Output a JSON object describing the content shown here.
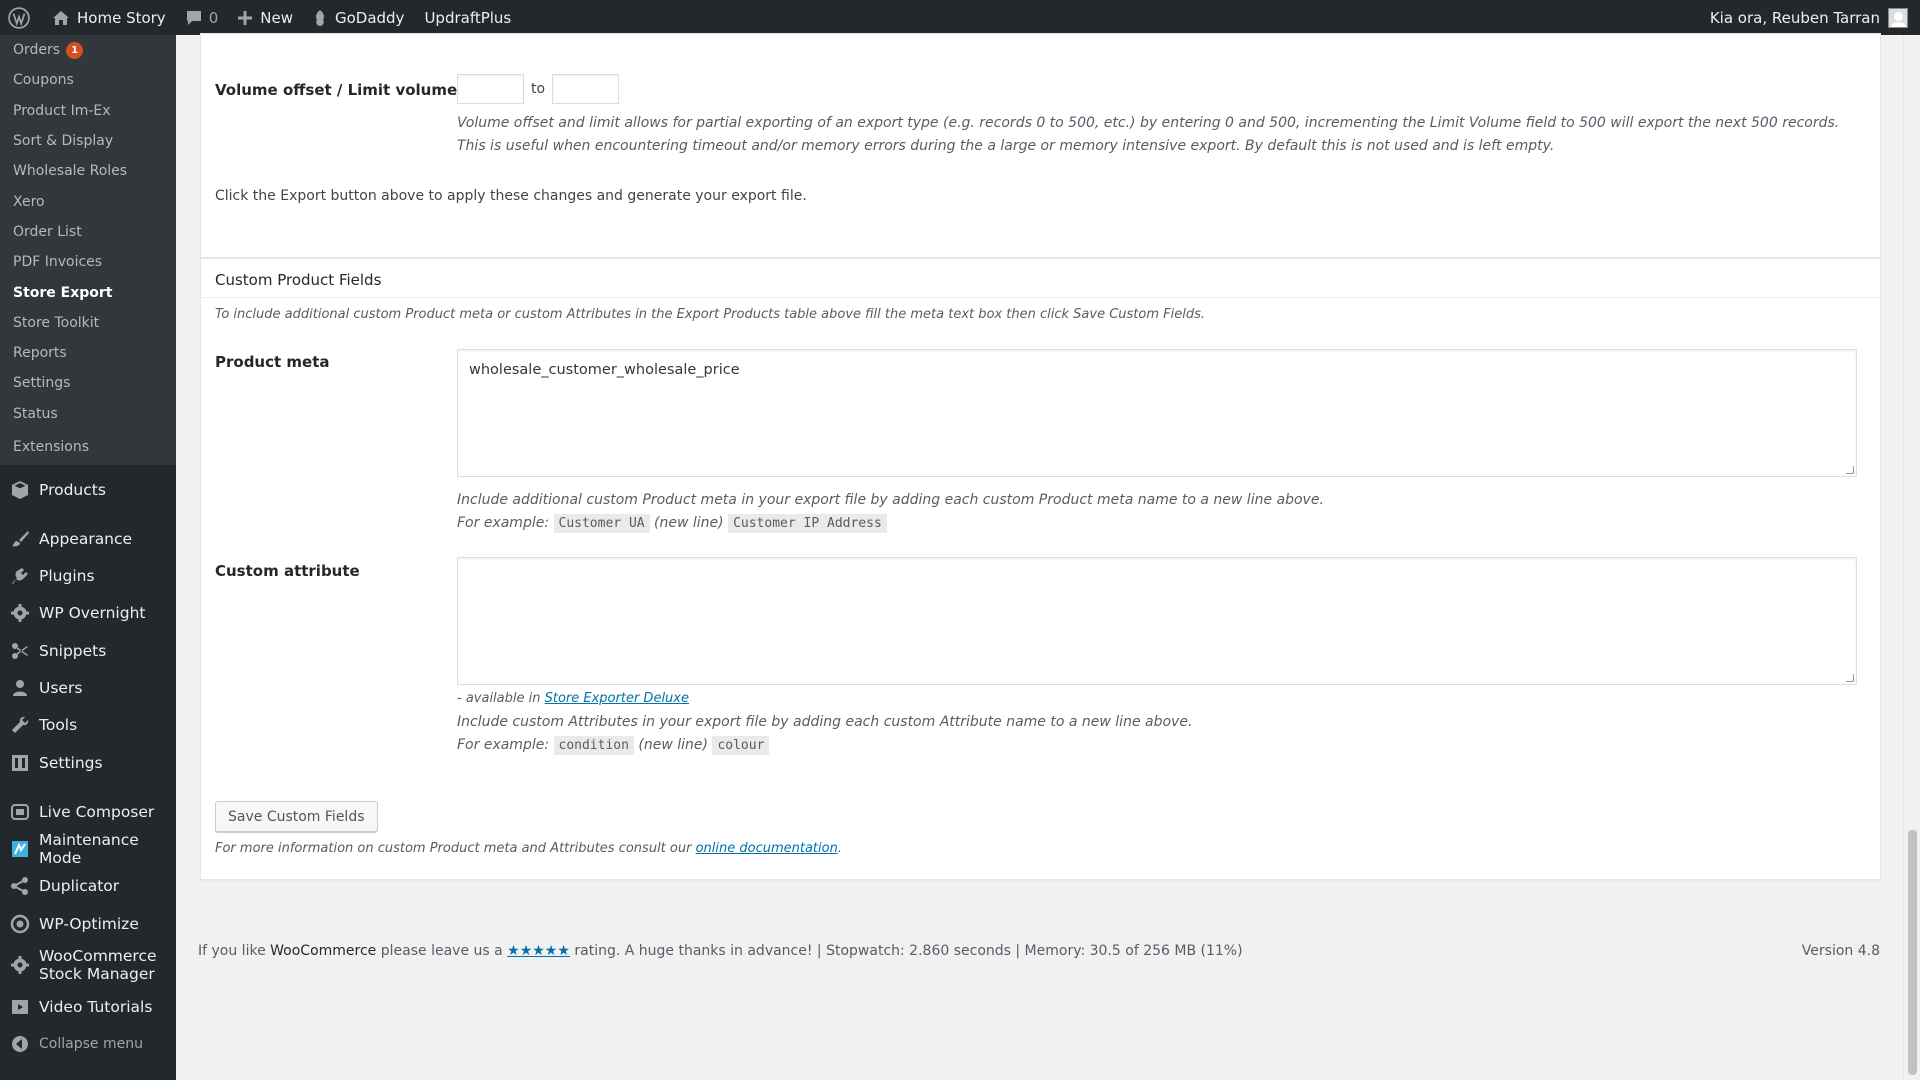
{
  "adminbar": {
    "site_name": "Home Story",
    "comments_count": "0",
    "new_label": "New",
    "godaddy_label": "GoDaddy",
    "updraft_label": "UpdraftPlus",
    "greeting": "Kia ora, Reuben Tarran"
  },
  "submenu": [
    {
      "label": "Orders",
      "badge": "1"
    },
    {
      "label": "Coupons"
    },
    {
      "label": "Product Im-Ex"
    },
    {
      "label": "Sort & Display"
    },
    {
      "label": "Wholesale Roles"
    },
    {
      "label": "Xero"
    },
    {
      "label": "Order List"
    },
    {
      "label": "PDF Invoices"
    },
    {
      "label": "Store Export",
      "current": true
    },
    {
      "label": "Store Toolkit"
    },
    {
      "label": "Reports"
    },
    {
      "label": "Settings"
    },
    {
      "label": "Status"
    },
    {
      "label": "Extensions"
    }
  ],
  "menu": {
    "products": "Products",
    "appearance": "Appearance",
    "plugins": "Plugins",
    "wp_overnight": "WP Overnight",
    "snippets": "Snippets",
    "users": "Users",
    "tools": "Tools",
    "settings": "Settings",
    "live_composer": "Live Composer",
    "maintenance_mode": "Maintenance Mode",
    "duplicator": "Duplicator",
    "wp_optimize": "WP-Optimize",
    "stock_manager_1": "WooCommerce",
    "stock_manager_2": "Stock Manager",
    "video_tutorials": "Video Tutorials",
    "collapse": "Collapse menu"
  },
  "volume": {
    "label": "Volume offset / Limit volume",
    "offset_value": "",
    "limit_value": "",
    "to_label": "to",
    "desc_line1": "Volume offset and limit allows for partial exporting of an export type (e.g. records 0 to 500, etc.) by entering 0 and 500, incrementing the Limit Volume field to 500 will export the next 500 records.",
    "desc_line2": "This is useful when encountering timeout and/or memory errors during the a large or memory intensive export. By default this is not used and is left empty.",
    "hint": "Click the Export button above to apply these changes and generate your export file."
  },
  "custom_fields": {
    "title": "Custom Product Fields",
    "intro": "To include additional custom Product meta or custom Attributes in the Export Products table above fill the meta text box then click Save Custom Fields.",
    "product_meta_label": "Product meta",
    "product_meta_value": "wholesale_customer_wholesale_price",
    "meta_desc": "Include additional custom Product meta in your export file by adding each custom Product meta name to a new line above.",
    "example_label": "For example:",
    "meta_example_1": "Customer UA",
    "new_line": "(new line)",
    "meta_example_2": "Customer IP Address",
    "custom_attribute_label": "Custom attribute",
    "custom_attribute_value": "",
    "available_prefix": "- available in",
    "available_link": "Store Exporter Deluxe",
    "attr_desc": "Include custom Attributes in your export file by adding each custom Attribute name to a new line above.",
    "attr_example_1": "condition",
    "attr_example_2": "colour",
    "save_button": "Save Custom Fields",
    "more_info": "For more information on custom Product meta and Attributes consult our",
    "doc_link": "online documentation",
    "period": "."
  },
  "footer": {
    "prefix": "If you like",
    "brand": "WooCommerce",
    "middle": "please leave us a",
    "stars": "★★★★★",
    "suffix": "rating. A huge thanks in advance! | Stopwatch: 2.860 seconds | Memory: 30.5 of 256 MB (11%)",
    "version": "Version 4.8"
  }
}
